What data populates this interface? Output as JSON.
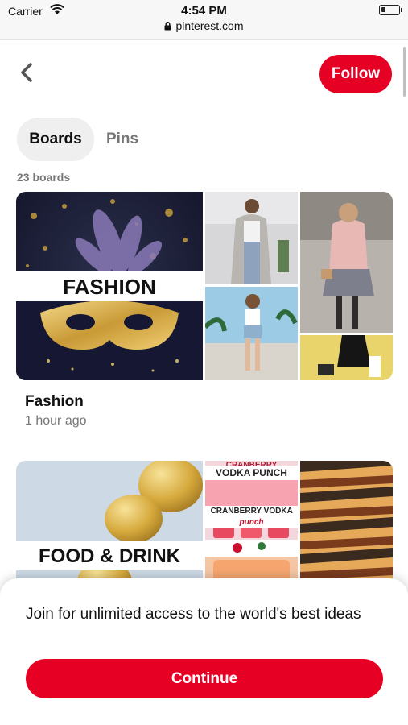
{
  "status_bar": {
    "carrier": "Carrier",
    "time": "4:54 PM",
    "url": "pinterest.com",
    "icons": [
      "wifi-icon",
      "lock-icon",
      "battery-icon"
    ]
  },
  "header": {
    "back_icon": "chevron-left-icon",
    "follow_label": "Follow"
  },
  "tabs": [
    {
      "label": "Boards",
      "selected": true
    },
    {
      "label": "Pins",
      "selected": false
    }
  ],
  "board_count": "23 boards",
  "boards": [
    {
      "cover_label": "FASHION",
      "title": "Fashion",
      "updated": "1 hour ago"
    },
    {
      "cover_label": "FOOD & DRINK",
      "pin_texts": [
        "CRANBERRY",
        "VODKA PUNCH",
        "CRANBERRY VODKA",
        "punch"
      ]
    }
  ],
  "signup_sheet": {
    "message": "Join for unlimited access to the world's best ideas",
    "continue_label": "Continue"
  },
  "colors": {
    "brand_red": "#e60023",
    "muted_text": "#767676",
    "tab_bg": "#efefef"
  }
}
